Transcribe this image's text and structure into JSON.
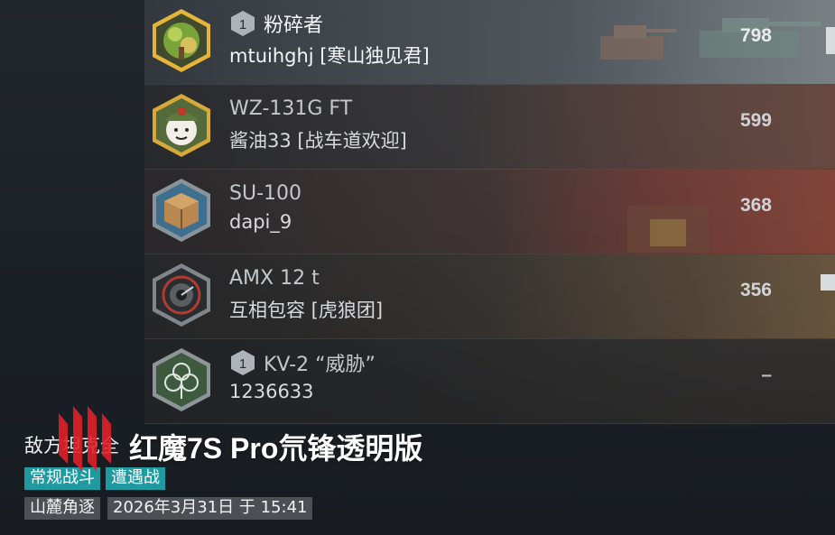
{
  "players": [
    {
      "rank_badge": "1",
      "vehicle": "粉碎者",
      "player": "mtuihghj [寒山独见君]",
      "score": "798",
      "emblem_icon": "gold-tree-emblem-icon",
      "highlight": true
    },
    {
      "rank_badge": "",
      "vehicle": "WZ-131G FT",
      "player": "酱油33 [战车道欢迎]",
      "score": "599",
      "emblem_icon": "cartoon-soldier-emblem-icon",
      "highlight": false
    },
    {
      "rank_badge": "",
      "vehicle": "SU-100",
      "player": "dapi_9",
      "score": "368",
      "emblem_icon": "crate-emblem-icon",
      "highlight": false
    },
    {
      "rank_badge": "",
      "vehicle": "AMX 12 t",
      "player": "互相包容 [虎狼团]",
      "score": "356",
      "emblem_icon": "gauge-emblem-icon",
      "highlight": false
    },
    {
      "rank_badge": "1",
      "vehicle": "KV-2 “威胁”",
      "player": "1236633",
      "score": "–",
      "emblem_icon": "clover-emblem-icon",
      "highlight": false
    }
  ],
  "footer": {
    "section_label": "敌方坦克全",
    "watermark": "红魔7S Pro氘锋透明版",
    "tags": [
      "常规战斗",
      "遭遇战"
    ],
    "map": "山麓角逐",
    "datetime": "2026年3月31日 于 15:41"
  },
  "colors": {
    "tag_bg": "#1f9aa0",
    "chip_bg": "#7c8084",
    "logo_red": "#e0202a",
    "emblem_gold": "#e7b43a"
  }
}
